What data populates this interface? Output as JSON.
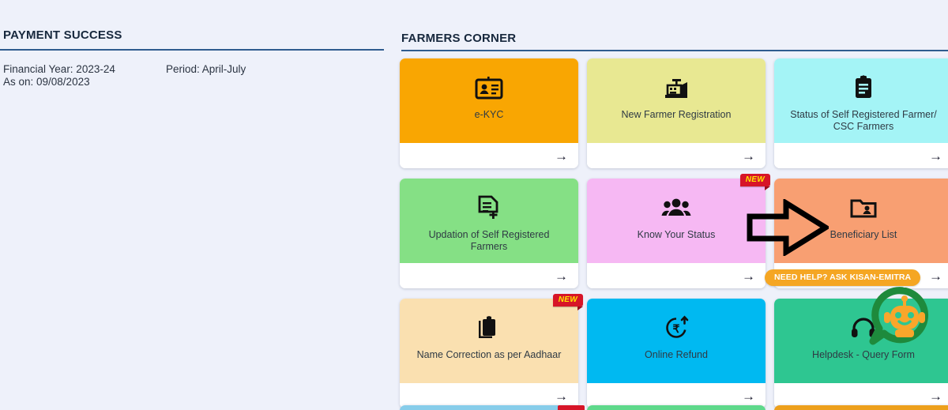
{
  "left": {
    "title": "PAYMENT SUCCESS",
    "financial_year": "Financial Year: 2023-24",
    "as_on": "As on: 09/08/2023",
    "period": "Period: April-July"
  },
  "farmers_corner": {
    "title": "FARMERS CORNER",
    "arrow_glyph": "→",
    "badge_new_label": "NEW",
    "cards": [
      {
        "label": "e-KYC",
        "icon": "id-card-icon",
        "color": "#f9a602",
        "new": false
      },
      {
        "label": "New Farmer Registration",
        "icon": "cash-register-icon",
        "color": "#e8e892",
        "new": false
      },
      {
        "label": "Status of Self Registered Farmer/ CSC Farmers",
        "icon": "clipboard-icon",
        "color": "#a4f4f6",
        "new": false
      },
      {
        "label": "Updation of Self Registered Farmers",
        "icon": "document-add-icon",
        "color": "#85e085",
        "new": false
      },
      {
        "label": "Know Your Status",
        "icon": "people-group-icon",
        "color": "#f6b8f3",
        "new": true
      },
      {
        "label": "Beneficiary List",
        "icon": "folder-person-icon",
        "color": "#f89f72",
        "new": false
      },
      {
        "label": "Name Correction as per Aadhaar",
        "icon": "clipboard-copy-icon",
        "color": "#fae0b0",
        "new": true
      },
      {
        "label": "Online Refund",
        "icon": "rupee-refund-icon",
        "color": "#00b9f1",
        "new": false
      },
      {
        "label": "Helpdesk - Query Form",
        "icon": "headphones-icon",
        "color": "#2ec691",
        "new": false
      }
    ],
    "partial_row_colors": [
      "#87cdea",
      "#5ed98b",
      "#eda01c"
    ]
  },
  "overlays": {
    "pointer_arrow_name": "pointer-arrow-to-beneficiary-list",
    "emitra_pill": "NEED HELP? ASK KISAN-EMITRA",
    "chatbot_name": "kisan-emitra-chatbot"
  },
  "colors": {
    "page_background": "#eef1fa",
    "rule": "#2f5c8f",
    "heading_text": "#17283d",
    "badge_new_bg": "#d71528",
    "badge_new_text": "#ffe600",
    "pill_bg": "#f5a623",
    "chatbot_ring": "#1e8a3c",
    "chatbot_body": "#f9a62b"
  }
}
